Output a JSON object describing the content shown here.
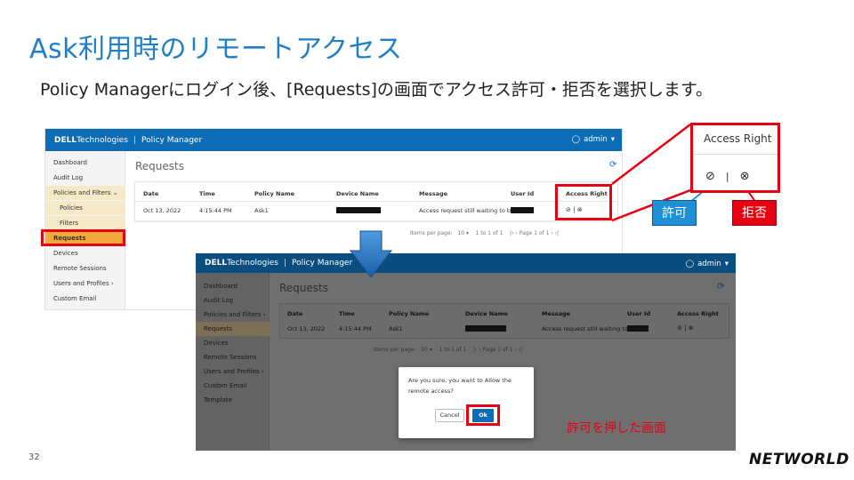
{
  "slide": {
    "title": "Ask利用時のリモートアクセス",
    "subtitle": "Policy Managerにログイン後、[Requests]の画面でアクセス許可・拒否を選択します。",
    "page_number": "32",
    "logo": "NETWORLD",
    "caption": "許可を押した画面",
    "allow_badge": "許可",
    "deny_badge": "拒否"
  },
  "app": {
    "brand_bold": "DELL",
    "brand_thin": "Technologies",
    "product": "Policy Manager",
    "user": "admin",
    "page_title": "Requests",
    "sidebar": {
      "dashboard": "Dashboard",
      "audit_log": "Audit Log",
      "policies_filters": "Policies and Filters",
      "policies": "Policies",
      "filters": "Filters",
      "requests": "Requests",
      "devices": "Devices",
      "remote_sessions": "Remote Sessions",
      "users_profiles": "Users and Profiles",
      "custom_email": "Custom Email Template"
    },
    "table": {
      "headers": {
        "date": "Date",
        "time": "Time",
        "policy": "Policy Name",
        "device": "Device Name",
        "message": "Message",
        "user": "User Id",
        "access": "Access Right"
      },
      "row": {
        "date": "Oct 13, 2022",
        "time": "4:15:44 PM",
        "policy": "Ask1",
        "message": "Access request still waiting to b..."
      }
    },
    "pager": {
      "items_label": "Items per page:",
      "items_value": "10",
      "range": "1 to 1 of 1",
      "page": "Page 1 of 1"
    }
  },
  "zoom": {
    "title": "Access Right"
  },
  "dialog": {
    "message": "Are you sure, you want to Allow the remote access?",
    "cancel": "Cancel",
    "ok": "Ok"
  }
}
